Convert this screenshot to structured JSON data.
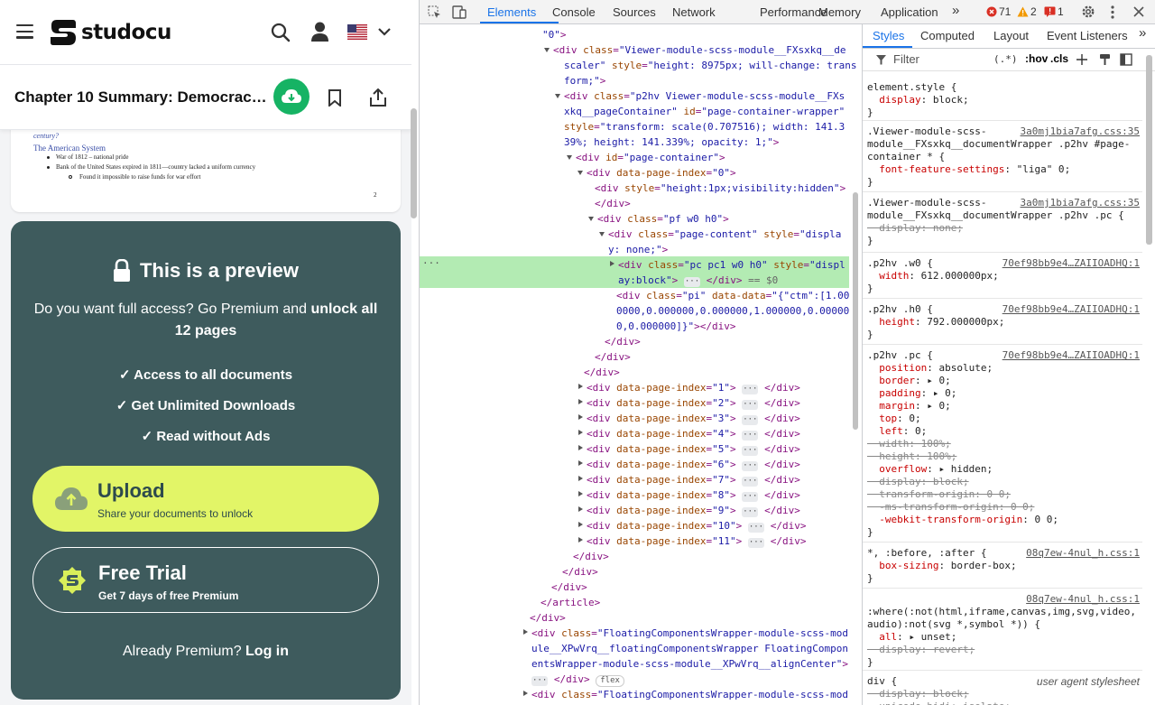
{
  "site": {
    "logo_text": "studocu",
    "doc_title": "Chapter 10 Summary: Democracy..."
  },
  "page_preview": {
    "century": "century?",
    "heading": "The American System",
    "line1": "War of 1812 – national pride",
    "line2": "Bank of the United States expired in 1811—country lacked a uniform currency",
    "line3": "Found it impossible to raise funds for war effort",
    "page_number": "2"
  },
  "paywall": {
    "title": "This is a preview",
    "subtitle_a": "Do you want full access? Go Premium and ",
    "subtitle_b": "unlock all 12 pages",
    "features": [
      "Access to all documents",
      "Get Unlimited Downloads",
      "Read without Ads"
    ],
    "upload_title": "Upload",
    "upload_sub": "Share your documents to unlock",
    "trial_title": "Free Trial",
    "trial_sub": "Get 7 days of free Premium",
    "already": "Already Premium? ",
    "login": "Log in"
  },
  "devtools": {
    "tabs": [
      "Elements",
      "Console",
      "Sources",
      "Network",
      "Performance",
      "Memory",
      "Application"
    ],
    "more": "»",
    "errors": "71",
    "warnings": "2",
    "issues": "1",
    "style_tabs": [
      "Styles",
      "Computed",
      "Layout",
      "Event Listeners"
    ],
    "filter_placeholder": "Filter",
    "hov": ":hov",
    "cls": ".cls",
    "regex": "(.*)"
  },
  "colors": {
    "brand_green": "#16b364",
    "preview_bg": "#3e5b5d",
    "upload_bg": "#e2f567",
    "tag": "#881280",
    "attr": "#994500",
    "value": "#1a1aa6",
    "prop": "#c80000",
    "selected_row": "#b3ebb3"
  }
}
